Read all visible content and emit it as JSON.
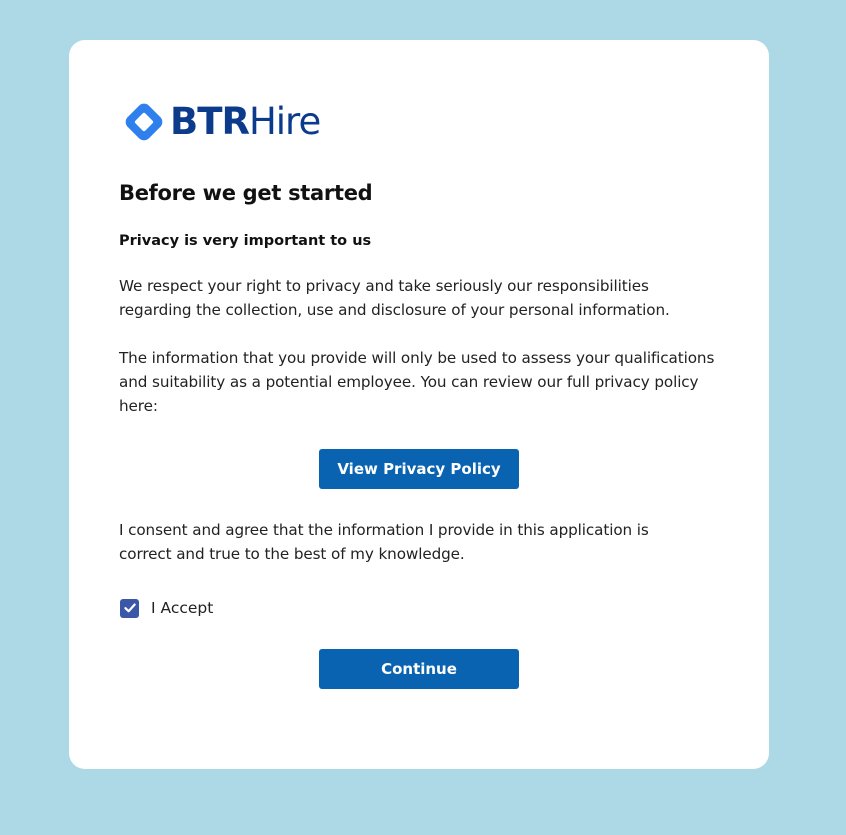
{
  "brand": {
    "logo_bold": "BTR",
    "logo_light": "Hire",
    "primary_color": "#0d3b8c",
    "icon_color": "#2f80ed",
    "icon": "diamond-logo-icon"
  },
  "content": {
    "heading": "Before we get started",
    "subheading": "Privacy is very important to us",
    "paragraph_1": "We respect your right to privacy and take seriously our responsibilities regarding the collection, use and disclosure of your personal information.",
    "paragraph_2": "The information that you provide will only be used to assess your qualifications and suitability as a potential employee. You can review our full privacy policy here:",
    "consent_text": "I consent and agree that the information I provide in this application is correct and true to the best of my knowledge."
  },
  "actions": {
    "privacy_button_label": "View Privacy Policy",
    "continue_button_label": "Continue",
    "button_color": "#0a63b0"
  },
  "consent": {
    "checkbox_label": "I Accept",
    "checked": true,
    "checkbox_color": "#3b57a8",
    "icon": "checkmark-icon"
  },
  "page": {
    "background_color": "#add8e6",
    "card_color": "#ffffff"
  }
}
